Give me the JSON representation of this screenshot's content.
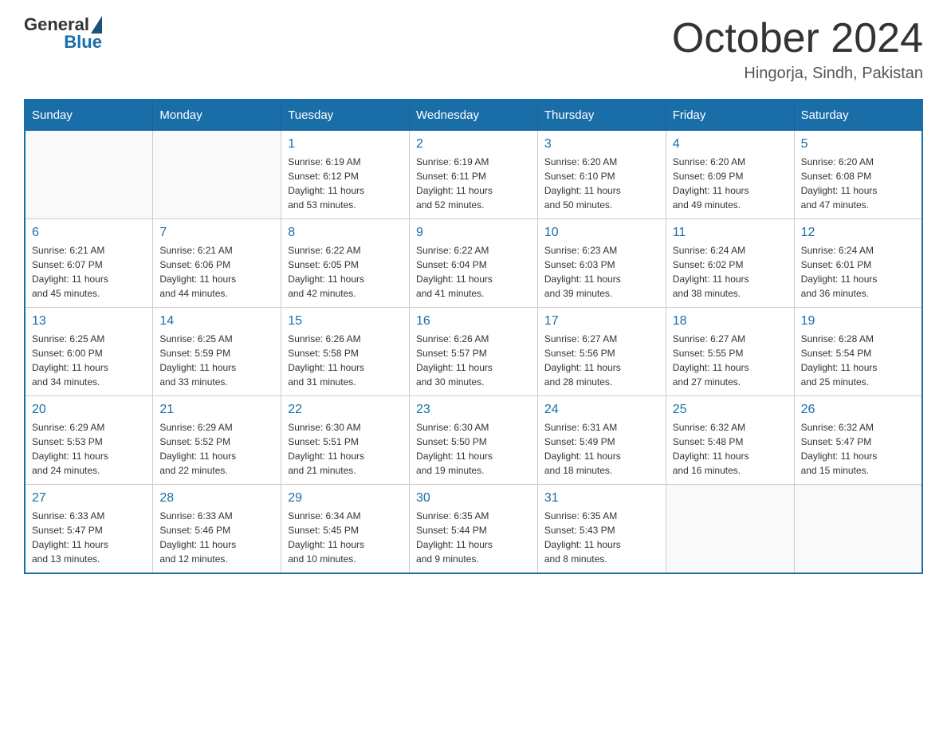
{
  "header": {
    "logo_general": "General",
    "logo_blue": "Blue",
    "title": "October 2024",
    "subtitle": "Hingorja, Sindh, Pakistan"
  },
  "calendar": {
    "days": [
      "Sunday",
      "Monday",
      "Tuesday",
      "Wednesday",
      "Thursday",
      "Friday",
      "Saturday"
    ],
    "weeks": [
      [
        {
          "num": "",
          "info": ""
        },
        {
          "num": "",
          "info": ""
        },
        {
          "num": "1",
          "info": "Sunrise: 6:19 AM\nSunset: 6:12 PM\nDaylight: 11 hours\nand 53 minutes."
        },
        {
          "num": "2",
          "info": "Sunrise: 6:19 AM\nSunset: 6:11 PM\nDaylight: 11 hours\nand 52 minutes."
        },
        {
          "num": "3",
          "info": "Sunrise: 6:20 AM\nSunset: 6:10 PM\nDaylight: 11 hours\nand 50 minutes."
        },
        {
          "num": "4",
          "info": "Sunrise: 6:20 AM\nSunset: 6:09 PM\nDaylight: 11 hours\nand 49 minutes."
        },
        {
          "num": "5",
          "info": "Sunrise: 6:20 AM\nSunset: 6:08 PM\nDaylight: 11 hours\nand 47 minutes."
        }
      ],
      [
        {
          "num": "6",
          "info": "Sunrise: 6:21 AM\nSunset: 6:07 PM\nDaylight: 11 hours\nand 45 minutes."
        },
        {
          "num": "7",
          "info": "Sunrise: 6:21 AM\nSunset: 6:06 PM\nDaylight: 11 hours\nand 44 minutes."
        },
        {
          "num": "8",
          "info": "Sunrise: 6:22 AM\nSunset: 6:05 PM\nDaylight: 11 hours\nand 42 minutes."
        },
        {
          "num": "9",
          "info": "Sunrise: 6:22 AM\nSunset: 6:04 PM\nDaylight: 11 hours\nand 41 minutes."
        },
        {
          "num": "10",
          "info": "Sunrise: 6:23 AM\nSunset: 6:03 PM\nDaylight: 11 hours\nand 39 minutes."
        },
        {
          "num": "11",
          "info": "Sunrise: 6:24 AM\nSunset: 6:02 PM\nDaylight: 11 hours\nand 38 minutes."
        },
        {
          "num": "12",
          "info": "Sunrise: 6:24 AM\nSunset: 6:01 PM\nDaylight: 11 hours\nand 36 minutes."
        }
      ],
      [
        {
          "num": "13",
          "info": "Sunrise: 6:25 AM\nSunset: 6:00 PM\nDaylight: 11 hours\nand 34 minutes."
        },
        {
          "num": "14",
          "info": "Sunrise: 6:25 AM\nSunset: 5:59 PM\nDaylight: 11 hours\nand 33 minutes."
        },
        {
          "num": "15",
          "info": "Sunrise: 6:26 AM\nSunset: 5:58 PM\nDaylight: 11 hours\nand 31 minutes."
        },
        {
          "num": "16",
          "info": "Sunrise: 6:26 AM\nSunset: 5:57 PM\nDaylight: 11 hours\nand 30 minutes."
        },
        {
          "num": "17",
          "info": "Sunrise: 6:27 AM\nSunset: 5:56 PM\nDaylight: 11 hours\nand 28 minutes."
        },
        {
          "num": "18",
          "info": "Sunrise: 6:27 AM\nSunset: 5:55 PM\nDaylight: 11 hours\nand 27 minutes."
        },
        {
          "num": "19",
          "info": "Sunrise: 6:28 AM\nSunset: 5:54 PM\nDaylight: 11 hours\nand 25 minutes."
        }
      ],
      [
        {
          "num": "20",
          "info": "Sunrise: 6:29 AM\nSunset: 5:53 PM\nDaylight: 11 hours\nand 24 minutes."
        },
        {
          "num": "21",
          "info": "Sunrise: 6:29 AM\nSunset: 5:52 PM\nDaylight: 11 hours\nand 22 minutes."
        },
        {
          "num": "22",
          "info": "Sunrise: 6:30 AM\nSunset: 5:51 PM\nDaylight: 11 hours\nand 21 minutes."
        },
        {
          "num": "23",
          "info": "Sunrise: 6:30 AM\nSunset: 5:50 PM\nDaylight: 11 hours\nand 19 minutes."
        },
        {
          "num": "24",
          "info": "Sunrise: 6:31 AM\nSunset: 5:49 PM\nDaylight: 11 hours\nand 18 minutes."
        },
        {
          "num": "25",
          "info": "Sunrise: 6:32 AM\nSunset: 5:48 PM\nDaylight: 11 hours\nand 16 minutes."
        },
        {
          "num": "26",
          "info": "Sunrise: 6:32 AM\nSunset: 5:47 PM\nDaylight: 11 hours\nand 15 minutes."
        }
      ],
      [
        {
          "num": "27",
          "info": "Sunrise: 6:33 AM\nSunset: 5:47 PM\nDaylight: 11 hours\nand 13 minutes."
        },
        {
          "num": "28",
          "info": "Sunrise: 6:33 AM\nSunset: 5:46 PM\nDaylight: 11 hours\nand 12 minutes."
        },
        {
          "num": "29",
          "info": "Sunrise: 6:34 AM\nSunset: 5:45 PM\nDaylight: 11 hours\nand 10 minutes."
        },
        {
          "num": "30",
          "info": "Sunrise: 6:35 AM\nSunset: 5:44 PM\nDaylight: 11 hours\nand 9 minutes."
        },
        {
          "num": "31",
          "info": "Sunrise: 6:35 AM\nSunset: 5:43 PM\nDaylight: 11 hours\nand 8 minutes."
        },
        {
          "num": "",
          "info": ""
        },
        {
          "num": "",
          "info": ""
        }
      ]
    ]
  }
}
